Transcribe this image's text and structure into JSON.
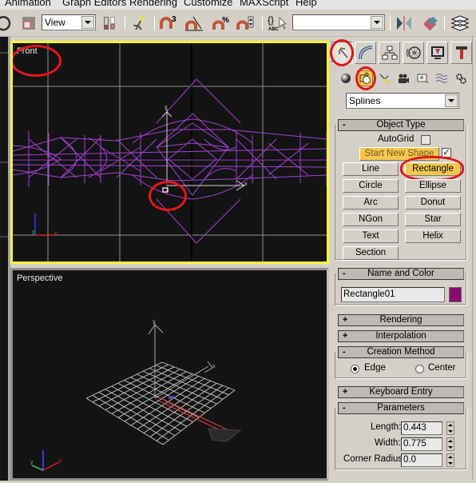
{
  "menubar": {
    "items": [
      "Animation",
      "Graph Editors",
      "Rendering",
      "Customize",
      "MAXScript",
      "Help"
    ]
  },
  "toolbar": {
    "icons": [
      "undo-icon",
      "select-region-icon",
      "reference-coordinate-combo",
      "use-pivot-icon",
      "manipulate-icon",
      "snap-3d-icon",
      "angle-snap-icon",
      "percent-snap-icon",
      "spinner-snap-icon",
      "edit-named-selection-icon",
      "named-selection-combo",
      "mirror-icon",
      "align-icon",
      "layer-manager-icon"
    ],
    "reference_coordinate": "View",
    "named_selection": ""
  },
  "viewports": {
    "front": {
      "label": "Front",
      "active": true
    },
    "perspective": {
      "label": "Perspective",
      "active": false
    }
  },
  "colors": {
    "active_viewport_border": "#f7f53a",
    "wireframe": "#a03fd0",
    "annotation_red": "#e0171b",
    "object_color": "#8b0a6e",
    "button_active": "#f5c84c",
    "viewport_bg": "#141414"
  },
  "command_panel": {
    "tabs": [
      "create-tab",
      "modify-tab",
      "hierarchy-tab",
      "motion-tab",
      "display-tab",
      "utilities-tab"
    ],
    "active_tab": "create-tab",
    "categories": [
      "geometry",
      "shapes",
      "lights",
      "cameras",
      "helpers",
      "space-warps",
      "systems"
    ],
    "active_category": "shapes",
    "subcategory": "Splines",
    "object_type": {
      "title": "Object Type",
      "collapse": "-",
      "autogrid_label": "AutoGrid",
      "autogrid_checked": false,
      "start_new_shape_label": "Start New Shape",
      "start_new_shape_checked": true,
      "buttons": [
        "Line",
        "Rectangle",
        "Circle",
        "Ellipse",
        "Arc",
        "Donut",
        "NGon",
        "Star",
        "Text",
        "Helix",
        "Section"
      ],
      "active_button": "Rectangle"
    },
    "name_and_color": {
      "title": "Name and Color",
      "collapse": "-",
      "name": "Rectangle01",
      "color": "#8b0a6e"
    },
    "rendering": {
      "title": "Rendering",
      "collapse": "+"
    },
    "interpolation": {
      "title": "Interpolation",
      "collapse": "+"
    },
    "creation_method": {
      "title": "Creation Method",
      "collapse": "-",
      "options": [
        "Edge",
        "Center"
      ],
      "selected": "Edge"
    },
    "keyboard_entry": {
      "title": "Keyboard Entry",
      "collapse": "+"
    },
    "parameters": {
      "title": "Parameters",
      "collapse": "-",
      "length_label": "Length:",
      "length": "0.443",
      "width_label": "Width:",
      "width": "0.775",
      "corner_radius_label": "Corner Radius:",
      "corner_radius": "0.0"
    }
  }
}
